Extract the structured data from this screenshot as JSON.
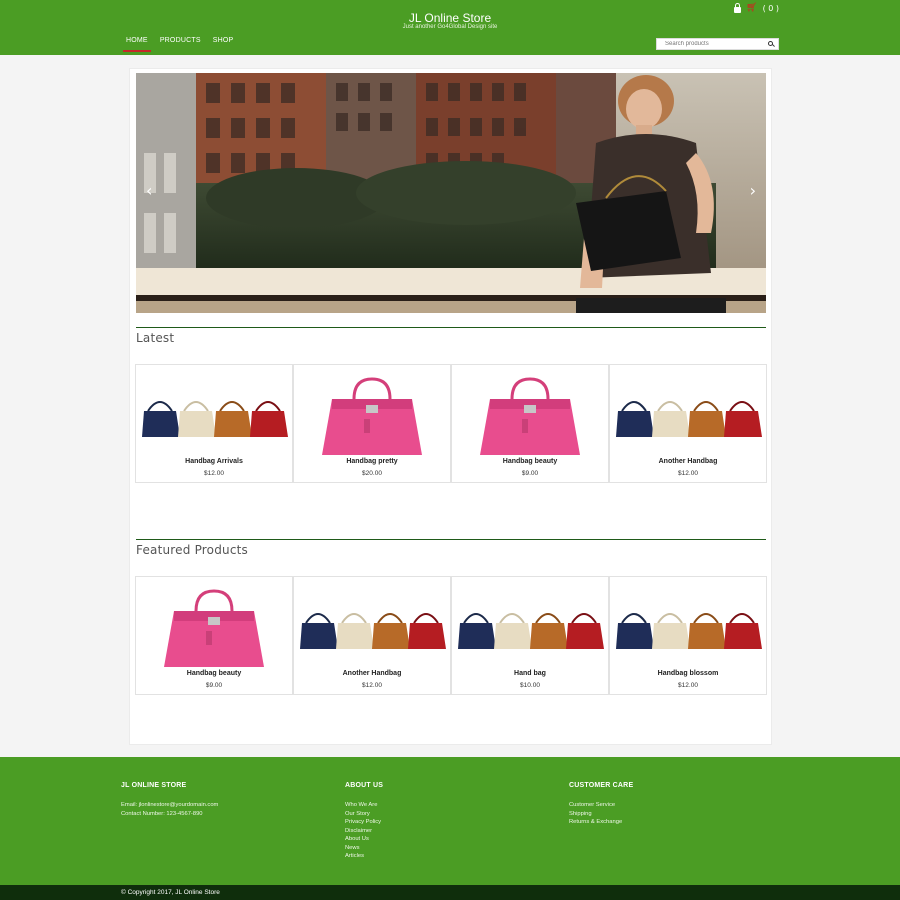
{
  "header": {
    "brand_title": "JL Online Store",
    "brand_tagline": "Just another Go4Global Design site",
    "cart_count": "( 0 )",
    "nav": [
      {
        "label": "HOME"
      },
      {
        "label": "PRODUCTS"
      },
      {
        "label": "SHOP"
      }
    ],
    "search_placeholder": "Search products",
    "accent_color": "#4b9d24",
    "active_underline_color": "#c62828"
  },
  "hero": {
    "prev_arrow": "‹",
    "next_arrow": "›"
  },
  "latest": {
    "title": "Latest",
    "products": [
      {
        "name": "Handbag Arrivals",
        "price": "$12.00",
        "image": "handbag-four-colors"
      },
      {
        "name": "Handbag pretty",
        "price": "$20.00",
        "image": "pink-handbag"
      },
      {
        "name": "Handbag beauty",
        "price": "$9.00",
        "image": "pink-handbag"
      },
      {
        "name": "Another Handbag",
        "price": "$12.00",
        "image": "handbag-four-colors"
      }
    ]
  },
  "featured": {
    "title": "Featured Products",
    "products": [
      {
        "name": "Handbag beauty",
        "price": "$9.00",
        "image": "pink-handbag"
      },
      {
        "name": "Another Handbag",
        "price": "$12.00",
        "image": "handbag-four-colors"
      },
      {
        "name": "Hand bag",
        "price": "$10.00",
        "image": "handbag-four-colors"
      },
      {
        "name": "Handbag blossom",
        "price": "$12.00",
        "image": "handbag-four-colors"
      }
    ]
  },
  "footer": {
    "col1": {
      "title": "JL ONLINE STORE",
      "email": "Email: jlonlinestore@yourdomain.com",
      "phone": "Contact Number: 123-4567-890"
    },
    "col2": {
      "title": "ABOUT US",
      "links": [
        "Who We Are",
        "Our Story",
        "Privacy Policy",
        "Disclaimer",
        "About Us",
        "News",
        "Articles"
      ]
    },
    "col3": {
      "title": "CUSTOMER CARE",
      "links": [
        "Customer Service",
        "Shipping",
        "Returns & Exchange"
      ]
    },
    "copyright": "© Copyright 2017, JL Online Store"
  }
}
